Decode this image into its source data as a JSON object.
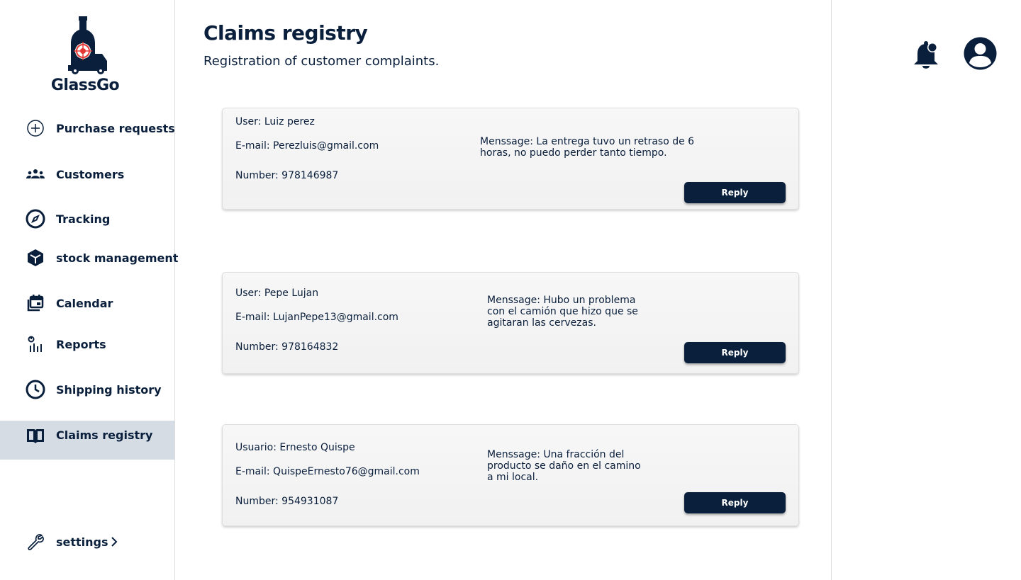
{
  "brand": {
    "name": "GlassGo",
    "accent": "#0a1f3c",
    "logo_target_color": "#e53935"
  },
  "sidebar": {
    "items": [
      {
        "label": "Purchase requests",
        "icon": "plus-circle-icon"
      },
      {
        "label": "Customers",
        "icon": "users-icon"
      },
      {
        "label": "Tracking",
        "icon": "compass-icon"
      },
      {
        "label": "stock management",
        "icon": "cube-icon"
      },
      {
        "label": "Calendar",
        "icon": "calendar-icon"
      },
      {
        "label": "Reports",
        "icon": "chart-icon"
      },
      {
        "label": "Shipping history",
        "icon": "clock-icon"
      },
      {
        "label": "Claims registry",
        "icon": "book-icon",
        "active": true
      }
    ],
    "settings": {
      "label": "settings",
      "icon": "wrench-icon"
    }
  },
  "page": {
    "title": "Claims registry",
    "subtitle": "Registration of customer complaints."
  },
  "claims": [
    {
      "user": "User: Luiz perez",
      "email": "E-mail: Perezluis@gmail.com",
      "number": "Number: 978146987",
      "message": "Menssage:  La entrega tuvo un retraso de 6 horas, no puedo perder tanto tiempo.",
      "reply_label": "Reply"
    },
    {
      "user": "User: Pepe Lujan",
      "email": "E-mail: LujanPepe13@gmail.com",
      "number": "Number: 978164832",
      "message": "Menssage: Hubo un problema con el camión que hizo que se agitaran las cervezas.",
      "reply_label": "Reply"
    },
    {
      "user": "Usuario: Ernesto Quispe",
      "email": "E-mail: QuispeErnesto76@gmail.com",
      "number": "Number: 954931087",
      "message": "Menssage: Una fracción del producto se daño en el camino a mi local.",
      "reply_label": "Reply"
    }
  ],
  "header": {
    "notification_icon": "bell-icon",
    "profile_icon": "user-avatar-icon"
  }
}
